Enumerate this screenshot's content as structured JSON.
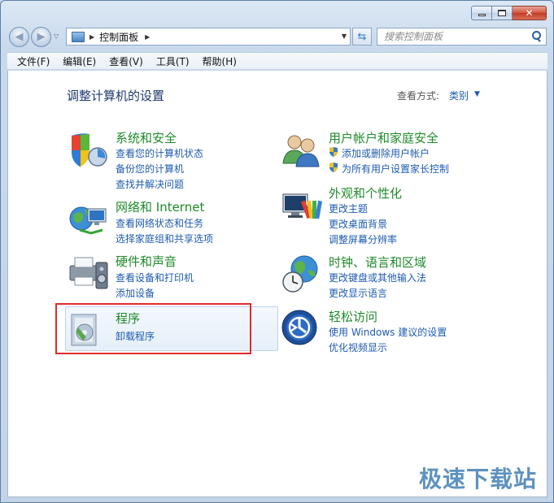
{
  "window": {
    "close_glyph": "✕"
  },
  "address": {
    "path": "控制面板"
  },
  "search": {
    "placeholder": "搜索控制面板"
  },
  "menu": [
    "文件(F)",
    "编辑(E)",
    "查看(V)",
    "工具(T)",
    "帮助(H)"
  ],
  "page": {
    "title": "调整计算机的设置",
    "view_by_label": "查看方式:",
    "view_by_value": "类别"
  },
  "categories": {
    "system_security": {
      "title": "系统和安全",
      "links": [
        "查看您的计算机状态",
        "备份您的计算机",
        "查找并解决问题"
      ]
    },
    "network": {
      "title": "网络和 Internet",
      "links": [
        "查看网络状态和任务",
        "选择家庭组和共享选项"
      ]
    },
    "hardware": {
      "title": "硬件和声音",
      "links": [
        "查看设备和打印机",
        "添加设备"
      ]
    },
    "programs": {
      "title": "程序",
      "links": [
        "卸载程序"
      ]
    },
    "user_accounts": {
      "title": "用户帐户和家庭安全",
      "links": [
        "添加或删除用户帐户",
        "为所有用户设置家长控制"
      ]
    },
    "appearance": {
      "title": "外观和个性化",
      "links": [
        "更改主题",
        "更改桌面背景",
        "调整屏幕分辨率"
      ]
    },
    "clock": {
      "title": "时钟、语言和区域",
      "links": [
        "更改键盘或其他输入法",
        "更改显示语言"
      ]
    },
    "ease": {
      "title": "轻松访问",
      "links": [
        "使用 Windows 建议的设置",
        "优化视频显示"
      ]
    }
  },
  "watermark": "极速下载站"
}
